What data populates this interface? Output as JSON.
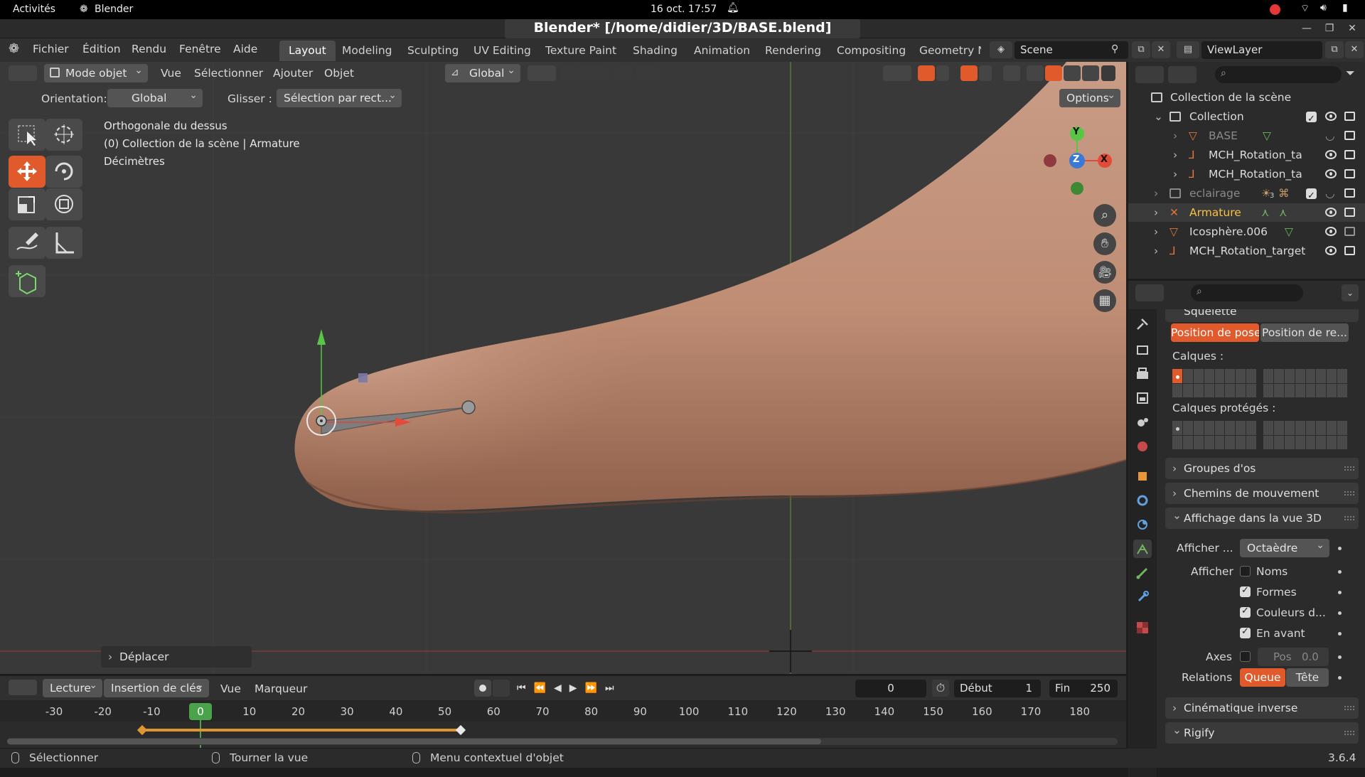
{
  "system_bar": {
    "activities": "Activités",
    "app_name": "Blender",
    "datetime": "16 oct.  17:57"
  },
  "window": {
    "title": "Blender* [/home/didier/3D/BASE.blend]"
  },
  "menu": {
    "items": [
      "Fichier",
      "Édition",
      "Rendu",
      "Fenêtre",
      "Aide"
    ]
  },
  "workspaces": {
    "tabs": [
      "Layout",
      "Modeling",
      "Sculpting",
      "UV Editing",
      "Texture Paint",
      "Shading",
      "Animation",
      "Rendering",
      "Compositing",
      "Geometry N"
    ],
    "active": "Layout",
    "scene": "Scene",
    "view_layer": "ViewLayer"
  },
  "viewport_header": {
    "mode": "Mode objet",
    "menus": [
      "Vue",
      "Sélectionner",
      "Ajouter",
      "Objet"
    ],
    "transform_orientation": "Global"
  },
  "tool_settings": {
    "orientation_label": "Orientation:",
    "orientation_value": "Global",
    "drag_label": "Glisser :",
    "drag_value": "Sélection par rect...",
    "options_label": "Options"
  },
  "viewport_overlay": {
    "view_name": "Orthogonale du dessus",
    "context": "(0) Collection de la scène | Armature",
    "units": "Décimètres"
  },
  "gizmo": {
    "y": "Y",
    "z": "Z",
    "x": "X"
  },
  "operator_panel": {
    "label": "Déplacer"
  },
  "outliner": {
    "root": "Collection de la scène",
    "rows": [
      {
        "name": "Collection",
        "indent": 1
      },
      {
        "name": "BASE",
        "indent": 2
      },
      {
        "name": "MCH_Rotation_ta",
        "indent": 2
      },
      {
        "name": "MCH_Rotation_ta",
        "indent": 2
      },
      {
        "name": "eclairage",
        "indent": 1
      },
      {
        "name": "Armature",
        "indent": 1
      },
      {
        "name": "Icosphère.006",
        "indent": 1
      },
      {
        "name": "MCH_Rotation_target",
        "indent": 1
      }
    ],
    "eclairage_count": "3"
  },
  "properties": {
    "section_partial": "Squelette",
    "pose_position": "Position de pose",
    "rest_position": "Position de re...",
    "layers_label": "Calques :",
    "protected_layers_label": "Calques protégés :",
    "panels": {
      "bone_groups": "Groupes d'os",
      "motion_paths": "Chemins de mouvement",
      "viewport_display": "Affichage dans la vue 3D",
      "ik": "Cinématique inverse",
      "rigify": "Rigify"
    },
    "display_as_label": "Afficher ...",
    "display_as_value": "Octaèdre",
    "show_label": "Afficher",
    "show_names": "Noms",
    "show_shapes": "Formes",
    "show_group_colors": "Couleurs d...",
    "in_front": "En avant",
    "axes_label": "Axes",
    "axes_pos_label": "Pos",
    "axes_pos_value": "0.0",
    "relations_label": "Relations",
    "relation_tail": "Queue",
    "relation_head": "Tête"
  },
  "timeline": {
    "playback": "Lecture",
    "keying": "Insertion de clés",
    "view": "Vue",
    "marker": "Marqueur",
    "current_frame": "0",
    "start_label": "Début",
    "start_value": "1",
    "end_label": "Fin",
    "end_value": "250",
    "ticks": [
      "-30",
      "-20",
      "-10",
      "0",
      "10",
      "20",
      "30",
      "40",
      "50",
      "60",
      "70",
      "80",
      "90",
      "100",
      "110",
      "120",
      "130",
      "140",
      "150",
      "160",
      "170",
      "180"
    ],
    "current_tick": "0"
  },
  "statusbar": {
    "select": "Sélectionner",
    "rotate_view": "Tourner la vue",
    "context_menu": "Menu contextuel d'objet",
    "version": "3.6.4"
  },
  "colors": {
    "accent": "#e05a2b",
    "skin": "#c18f76",
    "viewport_bg": "#393939"
  }
}
